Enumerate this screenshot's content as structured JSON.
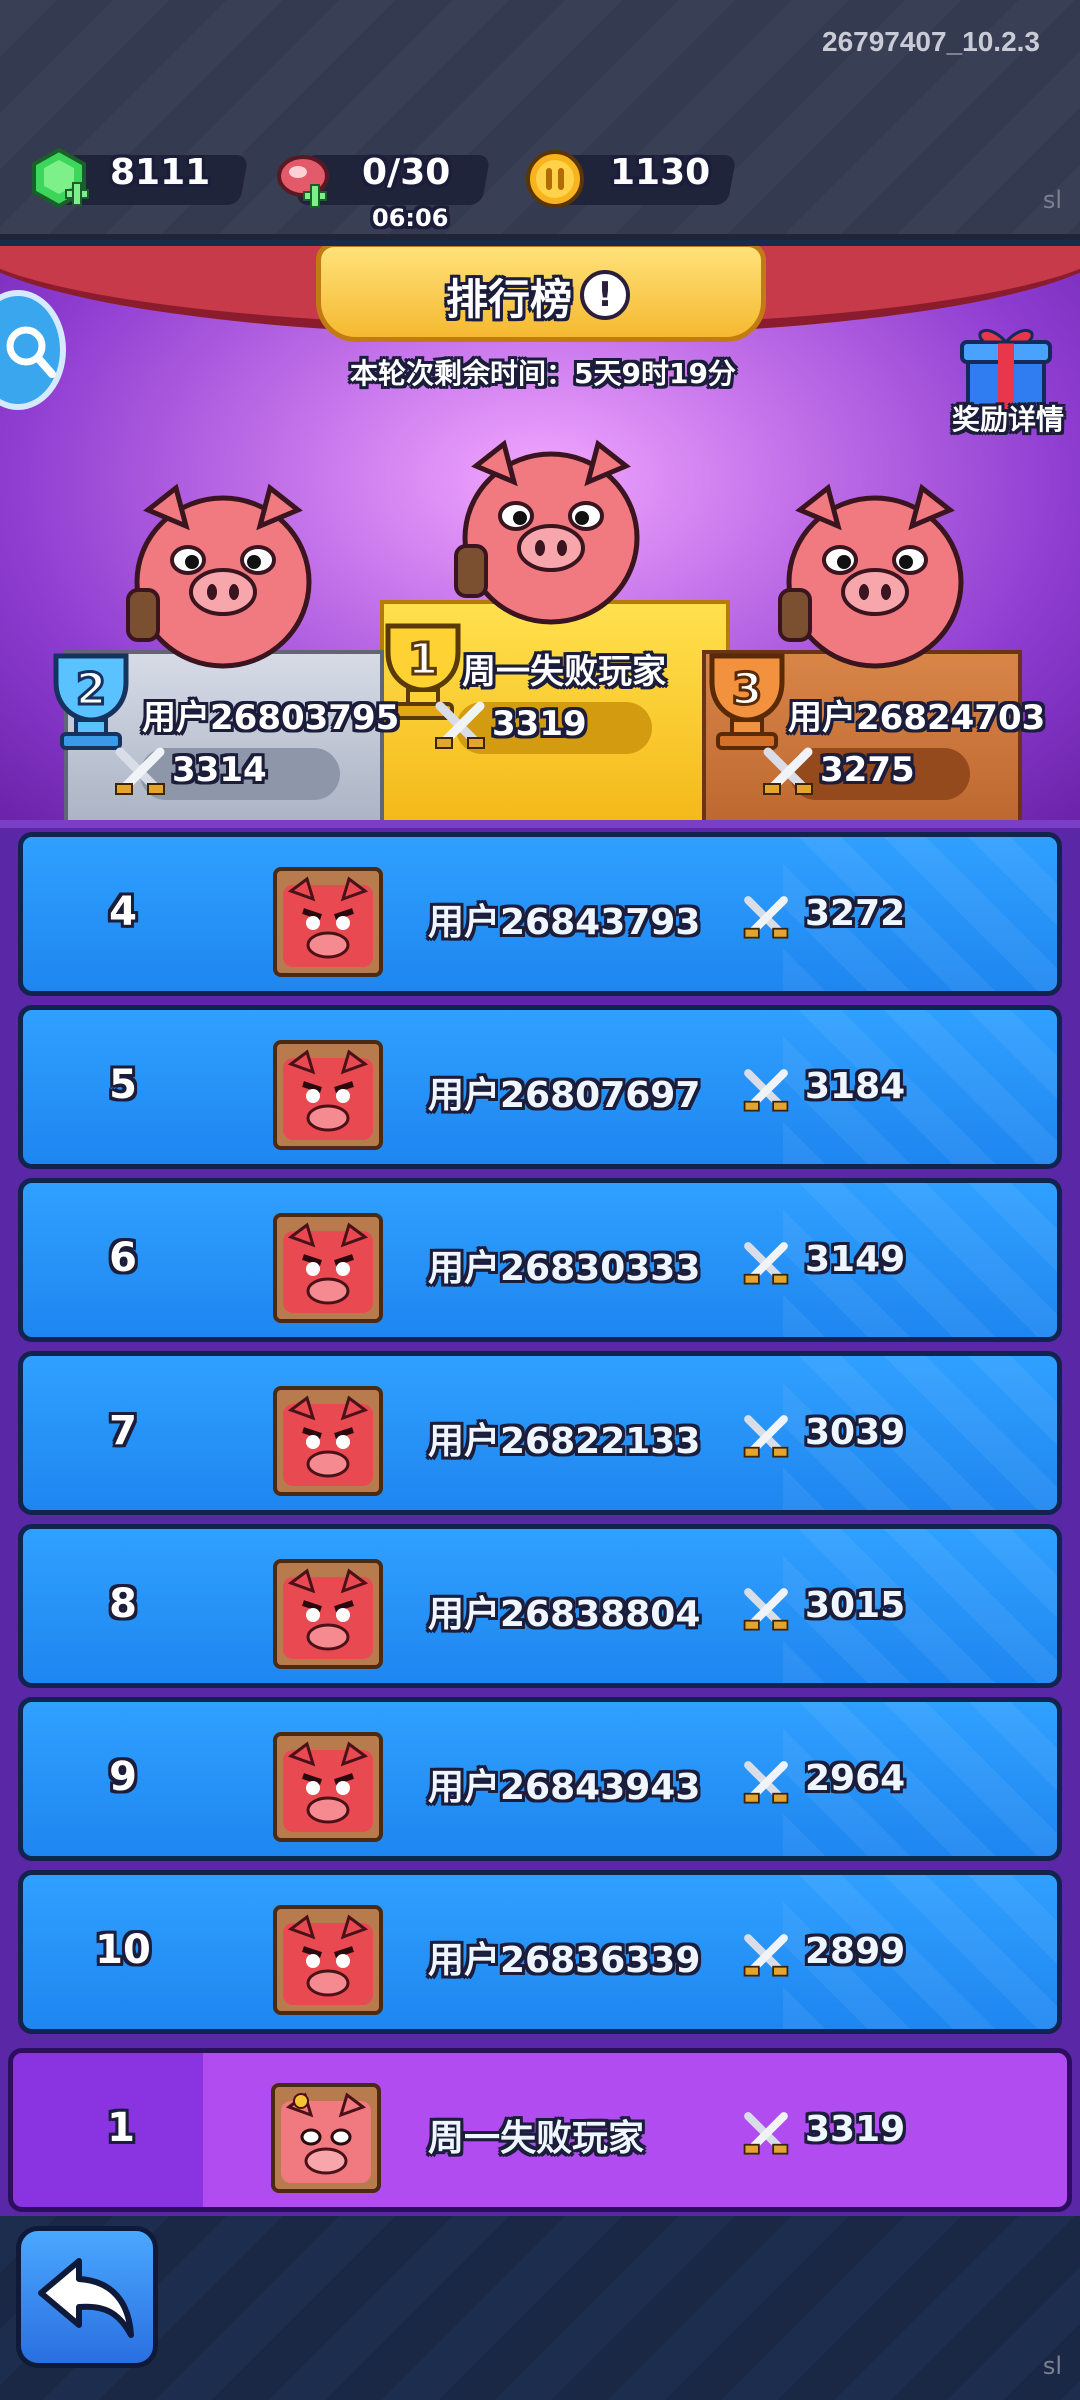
{
  "build_version": "26797407_10.2.3",
  "watermark": "sl",
  "resources": {
    "gems": "8111",
    "energy": "0/30",
    "energy_timer": "06:06",
    "coins": "1130"
  },
  "header": {
    "title": "排行榜",
    "info_symbol": "!",
    "remaining_time": "本轮次剩余时间：5天9时19分",
    "reward_details": "奖励详情"
  },
  "podium": {
    "first": {
      "rank": "1",
      "name": "周一失败玩家",
      "score": "3319"
    },
    "second": {
      "rank": "2",
      "name": "用户26803795",
      "score": "3314"
    },
    "third": {
      "rank": "3",
      "name": "用户26824703",
      "score": "3275"
    }
  },
  "rows": [
    {
      "rank": "4",
      "name": "用户26843793",
      "score": "3272"
    },
    {
      "rank": "5",
      "name": "用户26807697",
      "score": "3184"
    },
    {
      "rank": "6",
      "name": "用户26830333",
      "score": "3149"
    },
    {
      "rank": "7",
      "name": "用户26822133",
      "score": "3039"
    },
    {
      "rank": "8",
      "name": "用户26838804",
      "score": "3015"
    },
    {
      "rank": "9",
      "name": "用户26843943",
      "score": "2964"
    },
    {
      "rank": "10",
      "name": "用户26836339",
      "score": "2899"
    }
  ],
  "self_row": {
    "rank": "1",
    "name": "周一失败玩家",
    "score": "3319"
  },
  "colors": {
    "row_blue": "#2596f8",
    "self_purple": "#b14cf0",
    "gold": "#f7c531",
    "silver": "#b8c0d0",
    "bronze": "#c9753b"
  }
}
